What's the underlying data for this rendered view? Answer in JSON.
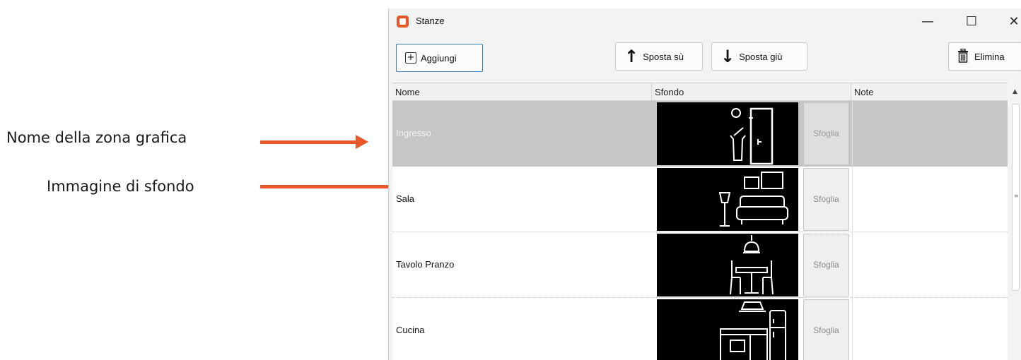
{
  "annotations": {
    "zone_name": "Nome della zona grafica",
    "background_image": "Immagine di sfondo",
    "accent_color": "#e8572a"
  },
  "window": {
    "title": "Stanze",
    "app_icon": "app-icon",
    "controls": {
      "minimize": "—",
      "maximize": "☐",
      "close": "✕"
    }
  },
  "toolbar": {
    "add_label": "Aggiungi",
    "move_up_label": "Sposta sù",
    "move_down_label": "Sposta giù",
    "delete_label": "Elimina",
    "icons": {
      "add": "plus-box-icon",
      "up": "arrow-up-icon",
      "down": "arrow-down-icon",
      "delete": "trash-icon"
    }
  },
  "grid": {
    "columns": [
      "Nome",
      "Sfondo",
      "Note"
    ],
    "rows": [
      {
        "name": "Ingresso",
        "image": "entrance-room-icon",
        "browse": "Sfoglia",
        "note": "",
        "selected": true
      },
      {
        "name": "Sala",
        "image": "living-room-icon",
        "browse": "Sfoglia",
        "note": "",
        "selected": false
      },
      {
        "name": "Tavolo Pranzo",
        "image": "dining-table-icon",
        "browse": "Sfoglia",
        "note": "",
        "selected": false
      },
      {
        "name": "Cucina",
        "image": "kitchen-icon",
        "browse": "Sfoglia",
        "note": "",
        "selected": false
      }
    ]
  }
}
